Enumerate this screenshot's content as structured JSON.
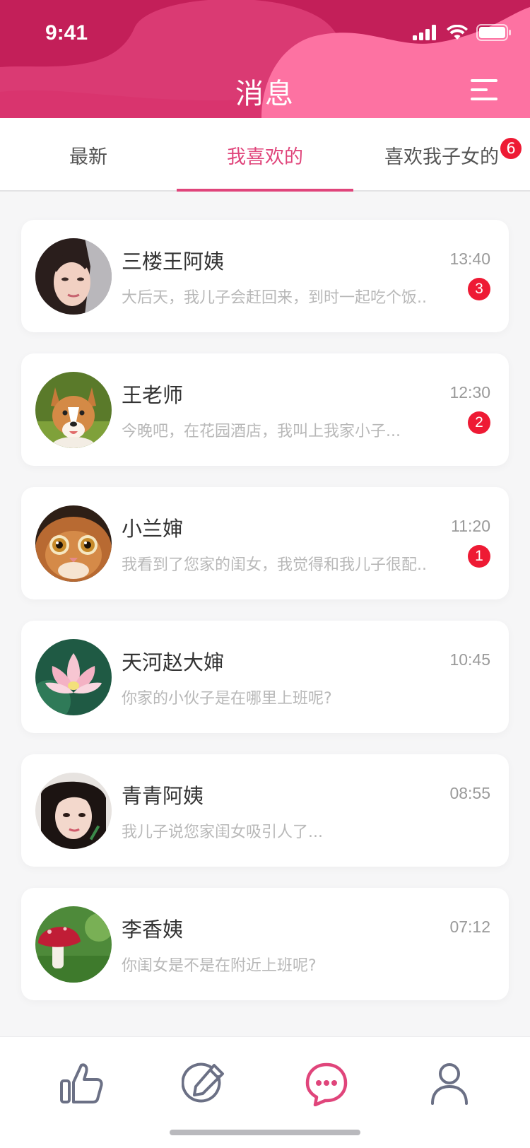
{
  "status_bar": {
    "time": "9:41"
  },
  "header": {
    "title": "消息"
  },
  "tabs": [
    {
      "label": "最新",
      "active": false
    },
    {
      "label": "我喜欢的",
      "active": true
    },
    {
      "label": "喜欢我子女的",
      "active": false,
      "badge": "6"
    }
  ],
  "messages": [
    {
      "name": "三楼王阿姨",
      "time": "13:40",
      "preview": "大后天，我儿子会赶回来，到时一起吃个饭..",
      "unread": "3",
      "avatar": "woman-portrait"
    },
    {
      "name": "王老师",
      "time": "12:30",
      "preview": "今晚吧，在花园酒店，我叫上我家小子...",
      "unread": "2",
      "avatar": "corgi-dog"
    },
    {
      "name": "小兰婶",
      "time": "11:20",
      "preview": "我看到了您家的闺女，我觉得和我儿子很配..",
      "unread": "1",
      "avatar": "cat"
    },
    {
      "name": "天河赵大婶",
      "time": "10:45",
      "preview": "你家的小伙子是在哪里上班呢?",
      "unread": "",
      "avatar": "lotus-flower"
    },
    {
      "name": "青青阿姨",
      "time": "08:55",
      "preview": "我儿子说您家闺女吸引人了...",
      "unread": "",
      "avatar": "girl-portrait"
    },
    {
      "name": "李香姨",
      "time": "07:12",
      "preview": "你闺女是不是在附近上班呢?",
      "unread": "",
      "avatar": "mushroom"
    }
  ],
  "bottom_nav": [
    {
      "icon": "thumbs-up-icon",
      "active": false
    },
    {
      "icon": "edit-icon",
      "active": false
    },
    {
      "icon": "chat-icon",
      "active": true
    },
    {
      "icon": "user-icon",
      "active": false
    }
  ],
  "colors": {
    "accent": "#e0457b",
    "header": "#c2205a",
    "badge": "#ee1a34"
  }
}
